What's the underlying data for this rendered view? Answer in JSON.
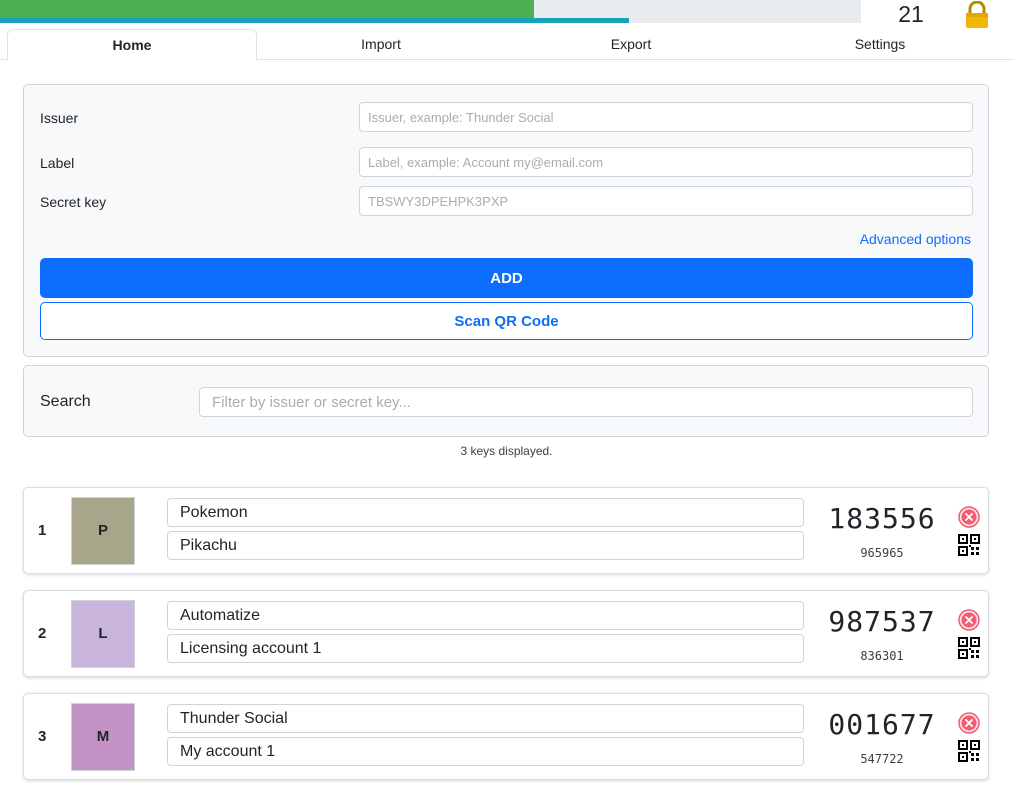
{
  "timer": {
    "seconds_left": "21",
    "progress_fraction": 0.62,
    "secondary_fraction": 0.73,
    "green": "#4caf50",
    "teal": "#17a2b8"
  },
  "lock_icon": "lock-icon",
  "tabs": [
    {
      "label": "Home",
      "active": true
    },
    {
      "label": "Import",
      "active": false
    },
    {
      "label": "Export",
      "active": false
    },
    {
      "label": "Settings",
      "active": false
    }
  ],
  "form": {
    "issuer_label": "Issuer",
    "issuer_placeholder": "Issuer, example: Thunder Social",
    "label_label": "Label",
    "label_placeholder": "Label, example: Account my@email.com",
    "secret_label": "Secret key",
    "secret_placeholder": "TBSWY3DPEHPK3PXP",
    "advanced_link": "Advanced options",
    "add_button": "ADD",
    "scan_button": "Scan QR Code",
    "accent": "#0d6efd"
  },
  "search": {
    "label": "Search",
    "placeholder": "Filter by issuer or secret key..."
  },
  "keys_count": "3 keys displayed.",
  "keys": [
    {
      "index": "1",
      "initial": "P",
      "color": "#a8a68a",
      "issuer": "Pokemon",
      "label": "Pikachu",
      "otp": "183556",
      "next_otp": "965965"
    },
    {
      "index": "2",
      "initial": "L",
      "color": "#c9b5dc",
      "issuer": "Automatize",
      "label": "Licensing account 1",
      "otp": "987537",
      "next_otp": "836301"
    },
    {
      "index": "3",
      "initial": "M",
      "color": "#c393c6",
      "issuer": "Thunder Social",
      "label": "My account 1",
      "otp": "001677",
      "next_otp": "547722"
    }
  ]
}
